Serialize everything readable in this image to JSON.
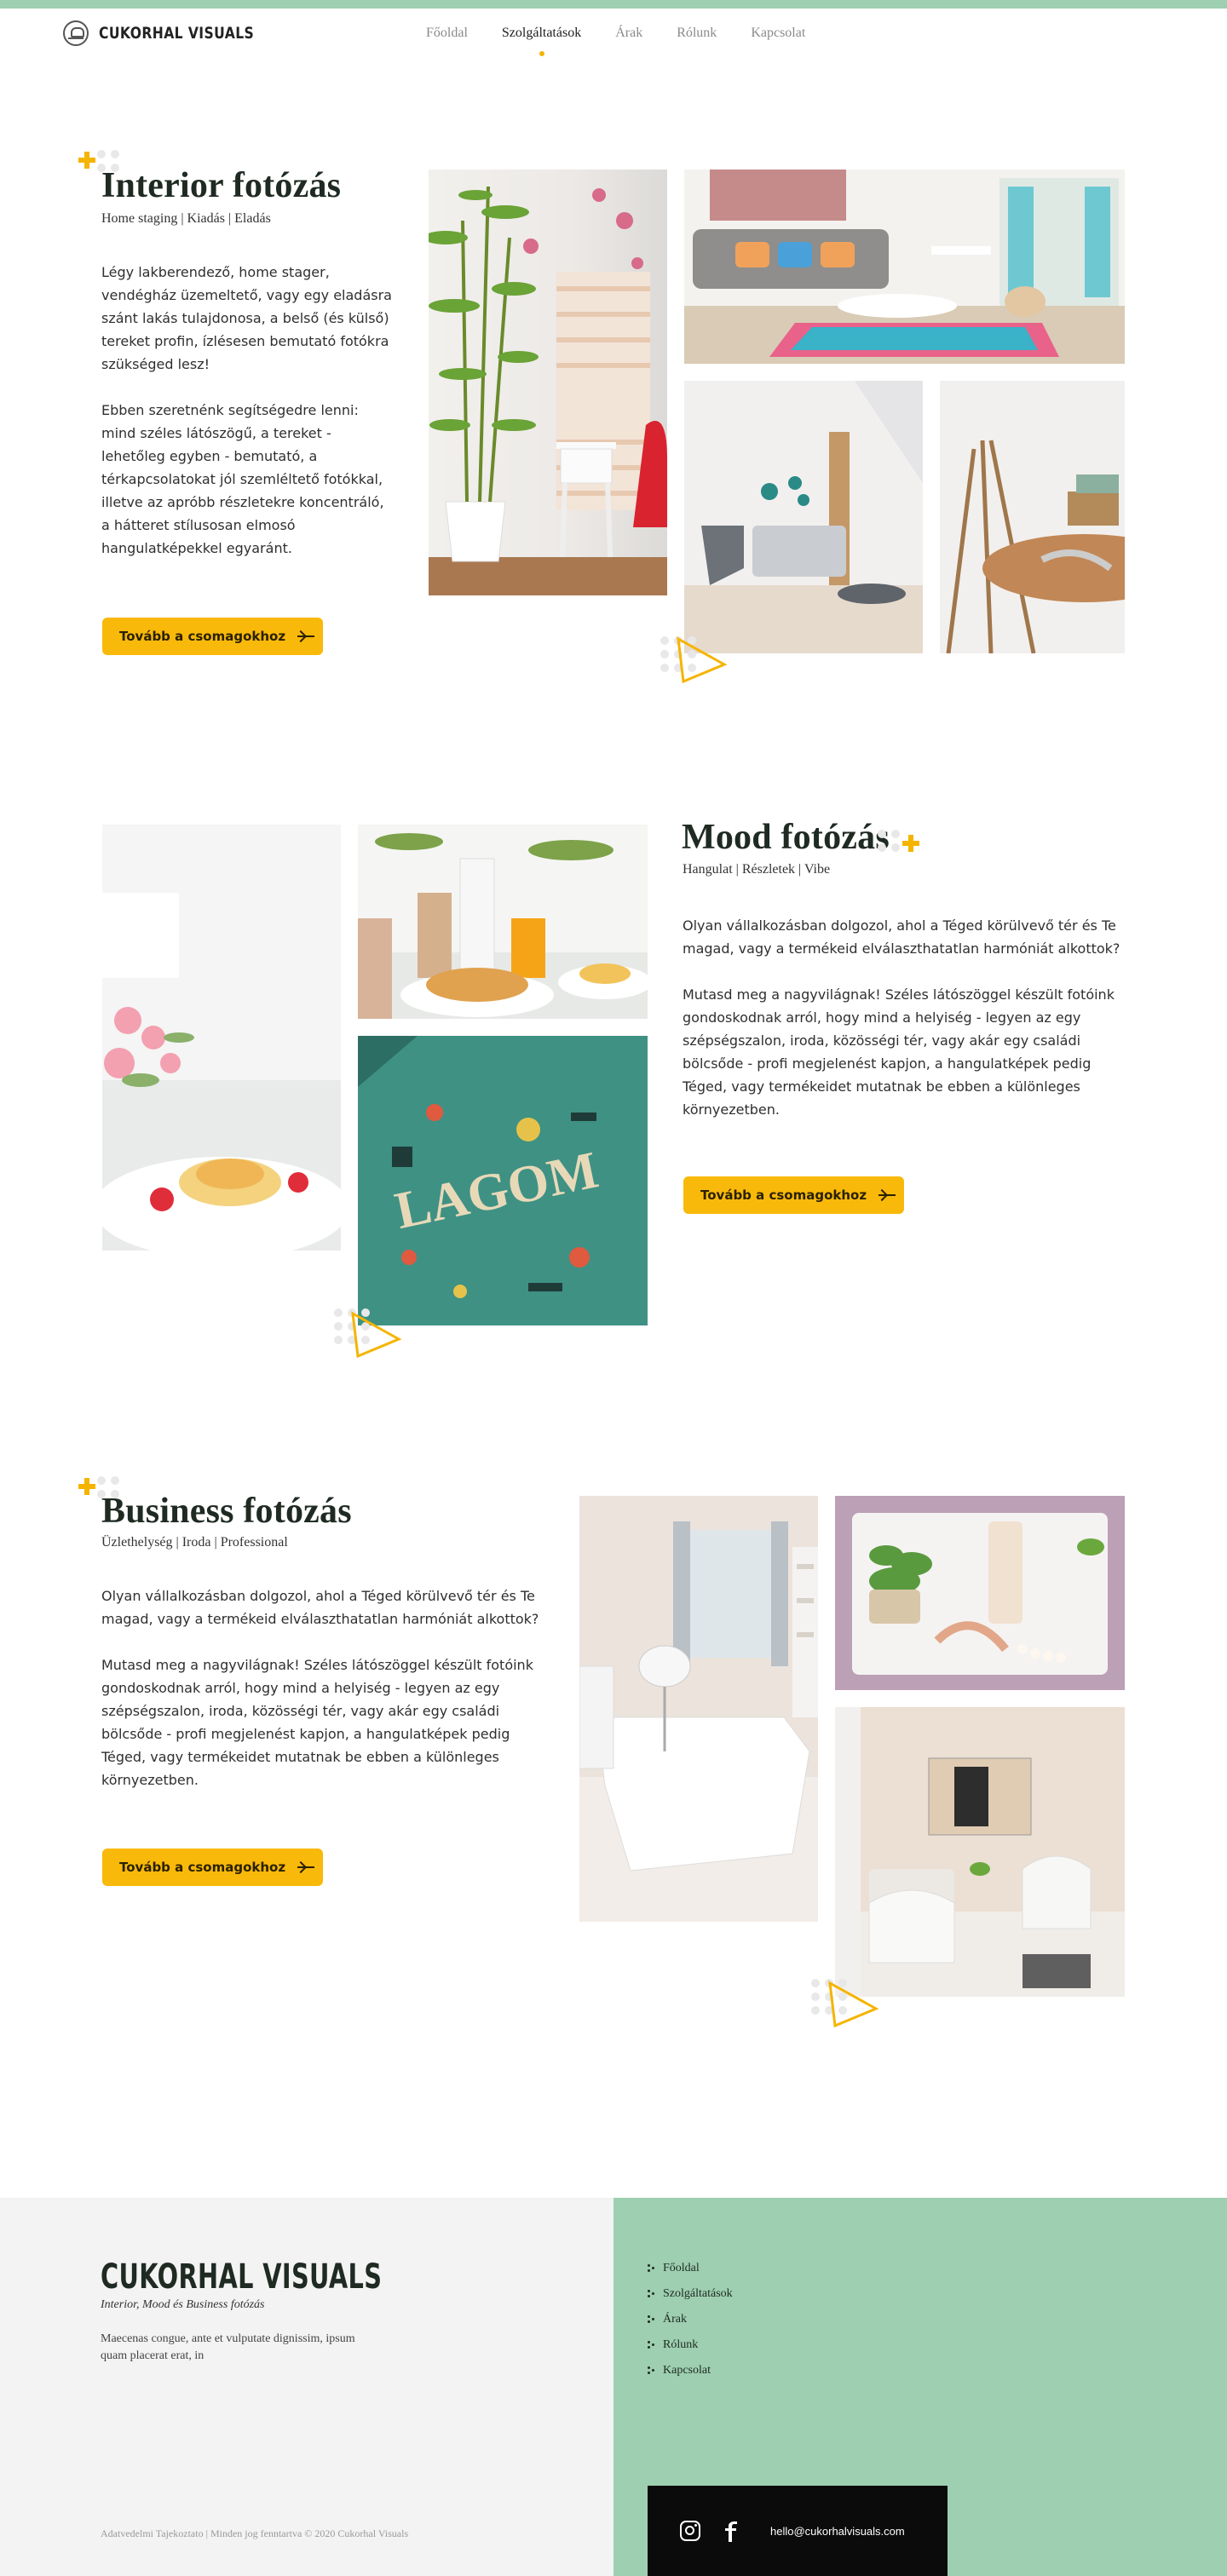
{
  "header": {
    "brand": "CUKORHAL VISUALS",
    "nav": [
      {
        "label": "Főoldal"
      },
      {
        "label": "Szolgáltatások",
        "active": true
      },
      {
        "label": "Árak"
      },
      {
        "label": "Rólunk"
      },
      {
        "label": "Kapcsolat"
      }
    ]
  },
  "colors": {
    "accent": "#f9b90a",
    "mint": "#9dcfb0",
    "dark": "#1f2a22"
  },
  "sections": {
    "interior": {
      "title": "Interior fotózás",
      "subtitle": "Home staging | Kiadás | Eladás",
      "p1": "Légy lakberendező, home stager, vendégház üzemeltető, vagy egy eladásra szánt lakás tulajdonosa, a belső (és külső) tereket profin, ízlésesen bemutató fotókra szükséged lesz!",
      "p2": "Ebben szeretnénk segítségedre lenni: mind széles látószögű, a tereket - lehetőleg egyben - bemutató, a térkapcsolatokat jól szemléltető fotókkal, illetve az apróbb részletekre koncentráló, a hátteret stílusosan elmosó hangulatképekkel egyaránt.",
      "cta": "Tovább a csomagokhoz"
    },
    "mood": {
      "title": "Mood fotózás",
      "subtitle": "Hangulat | Részletek | Vibe",
      "p1": "Olyan vállalkozásban dolgozol, ahol a Téged körülvevő tér és Te magad, vagy a termékeid elválaszthatatlan harmóniát alkottok?",
      "p2": "Mutasd meg a nagyvilágnak! Széles látószöggel készült fotóink gondoskodnak arról, hogy mind a helyiség - legyen az egy szépségszalon, iroda, közösségi tér, vagy akár egy családi bölcsőde - profi megjelenést kapjon, a hangulatképek pedig Téged, vagy termékeidet mutatnak be ebben a különleges környezetben.",
      "cta": "Tovább a csomagokhoz"
    },
    "business": {
      "title": "Business fotózás",
      "subtitle": "Üzlethelység | Iroda | Professional",
      "p1": "Olyan vállalkozásban dolgozol, ahol a Téged körülvevő tér és Te magad, vagy a termékeid elválaszthatatlan harmóniát alkottok?",
      "p2": "Mutasd meg a nagyvilágnak! Széles látószöggel készült fotóink gondoskodnak arról, hogy mind a helyiség - legyen az egy szépségszalon, iroda, közösségi tér, vagy akár egy családi bölcsőde - profi megjelenést kapjon, a hangulatképek pedig Téged, vagy termékeidet mutatnak be ebben a különleges környezetben.",
      "cta": "Tovább a csomagokhoz"
    }
  },
  "footer": {
    "brand": "CUKORHAL VISUALS",
    "tagline": "Interior, Mood és Business fotózás",
    "description": "Maecenas congue, ante et vulputate dignissim, ipsum quam placerat erat, in",
    "legal": "Adatvedelmi Tajekoztato | Minden jog fenntartva © 2020 Cukorhal Visuals",
    "links": [
      {
        "label": "Főoldal"
      },
      {
        "label": "Szolgáltatások"
      },
      {
        "label": "Árak"
      },
      {
        "label": "Rólunk"
      },
      {
        "label": "Kapcsolat"
      }
    ],
    "email": "hello@cukorhalvisuals.com",
    "icons": [
      "instagram-icon",
      "facebook-icon"
    ]
  }
}
